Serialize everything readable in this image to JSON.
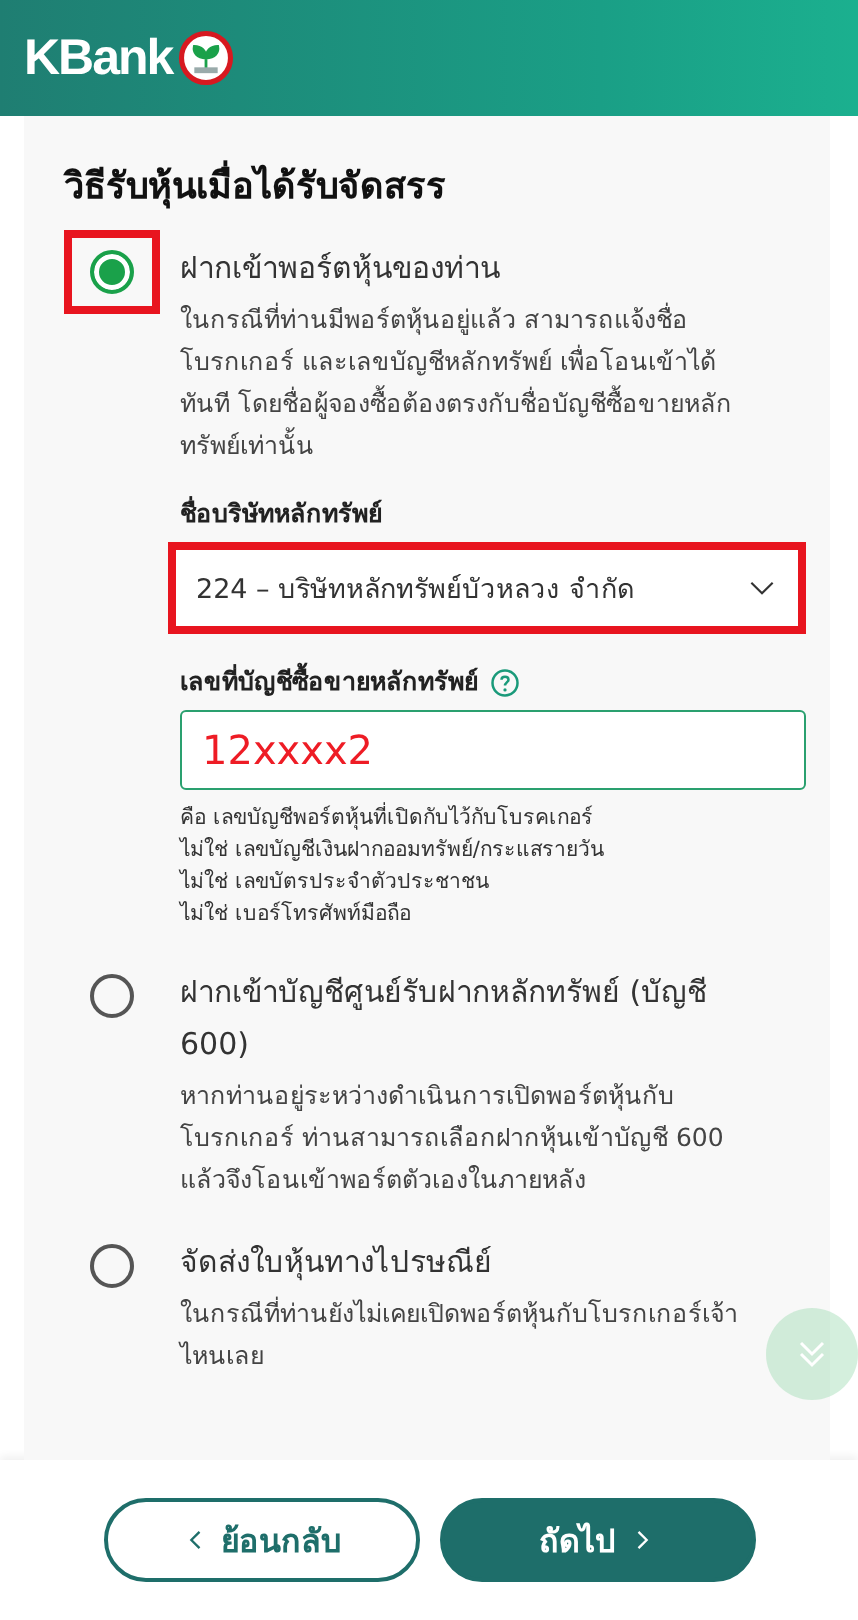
{
  "header": {
    "logo": "KBank"
  },
  "section_title": "วิธีรับหุ้นเมื่อได้รับจัดสรร",
  "options": [
    {
      "label": "ฝากเข้าพอร์ตหุ้นของท่าน",
      "description": "ในกรณีที่ท่านมีพอร์ตหุ้นอยู่แล้ว สามารถแจ้งชื่อโบรกเกอร์ และเลขบัญชีหลักทรัพย์ เพื่อโอนเข้าได้ทันที โดยชื่อผู้จองซื้อต้องตรงกับชื่อบัญชีซื้อขายหลักทรัพย์เท่านั้น",
      "selected": true,
      "highlighted": true,
      "fields": [
        {
          "kind": "select",
          "label": "ชื่อบริษัทหลักทรัพย์",
          "value": "224 – บริษัทหลักทรัพย์บัวหลวง จำกัด",
          "highlighted": true
        },
        {
          "kind": "text",
          "label": "เลขที่บัญชีซื้อขายหลักทรัพย์",
          "value": "12xxxx2",
          "highlighted": true,
          "help": true,
          "notes": [
            "คือ เลขบัญชีพอร์ตหุ้นที่เปิดกับไว้กับโบรคเกอร์",
            "ไม่ใช่ เลขบัญชีเงินฝากออมทรัพย์/กระแสรายวัน",
            "ไม่ใช่ เลขบัตรประจำตัวประชาชน",
            "ไม่ใช่ เบอร์โทรศัพท์มือถือ"
          ]
        }
      ]
    },
    {
      "label": "ฝากเข้าบัญชีศูนย์รับฝากหลักทรัพย์ (บัญชี 600)",
      "description": "หากท่านอยู่ระหว่างดำเนินการเปิดพอร์ตหุ้นกับโบรกเกอร์ ท่านสามารถเลือกฝากหุ้นเข้าบัญชี 600 แล้วจึงโอนเข้าพอร์ตตัวเองในภายหลัง",
      "selected": false,
      "highlighted": false
    },
    {
      "label": "จัดส่งใบหุ้นทางไปรษณีย์",
      "description": "ในกรณีที่ท่านยังไม่เคยเปิดพอร์ตหุ้นกับโบรกเกอร์เจ้าไหนเลย",
      "selected": false,
      "highlighted": false
    }
  ],
  "buttons": [
    {
      "kind": "back",
      "label": "ย้อนกลับ"
    },
    {
      "kind": "next",
      "label": "ถัดไป"
    }
  ]
}
